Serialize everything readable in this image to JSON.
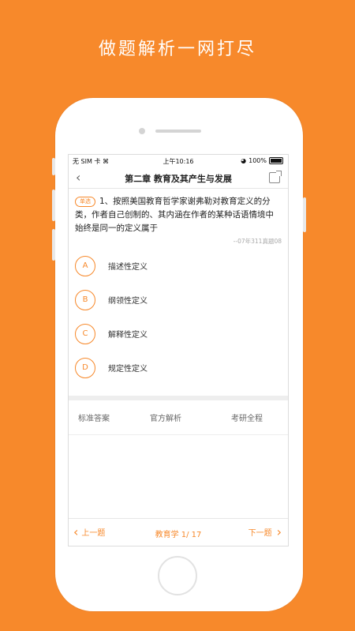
{
  "headline": "做题解析一网打尽",
  "statusbar": {
    "carrier": "无 SIM 卡",
    "time": "上午10:16",
    "battery": "100%"
  },
  "navbar": {
    "title": "第二章 教育及其产生与发展"
  },
  "question": {
    "tag": "单选",
    "text": "1、按照美国教育哲学家谢弗勒对教育定义的分类，作者自己创制的、其内涵在作者的某种话语情境中始终是同一的定义属于",
    "source": "--07年311真题08"
  },
  "options": [
    {
      "letter": "A",
      "text": "描述性定义"
    },
    {
      "letter": "B",
      "text": "纲领性定义"
    },
    {
      "letter": "C",
      "text": "解释性定义"
    },
    {
      "letter": "D",
      "text": "规定性定义"
    }
  ],
  "tabs": [
    "标准答案",
    "官方解析",
    "考研全程"
  ],
  "bottombar": {
    "prev": "上一题",
    "position": "教育学 1/ 17",
    "next": "下一题"
  },
  "colors": {
    "accent": "#f7892b"
  }
}
